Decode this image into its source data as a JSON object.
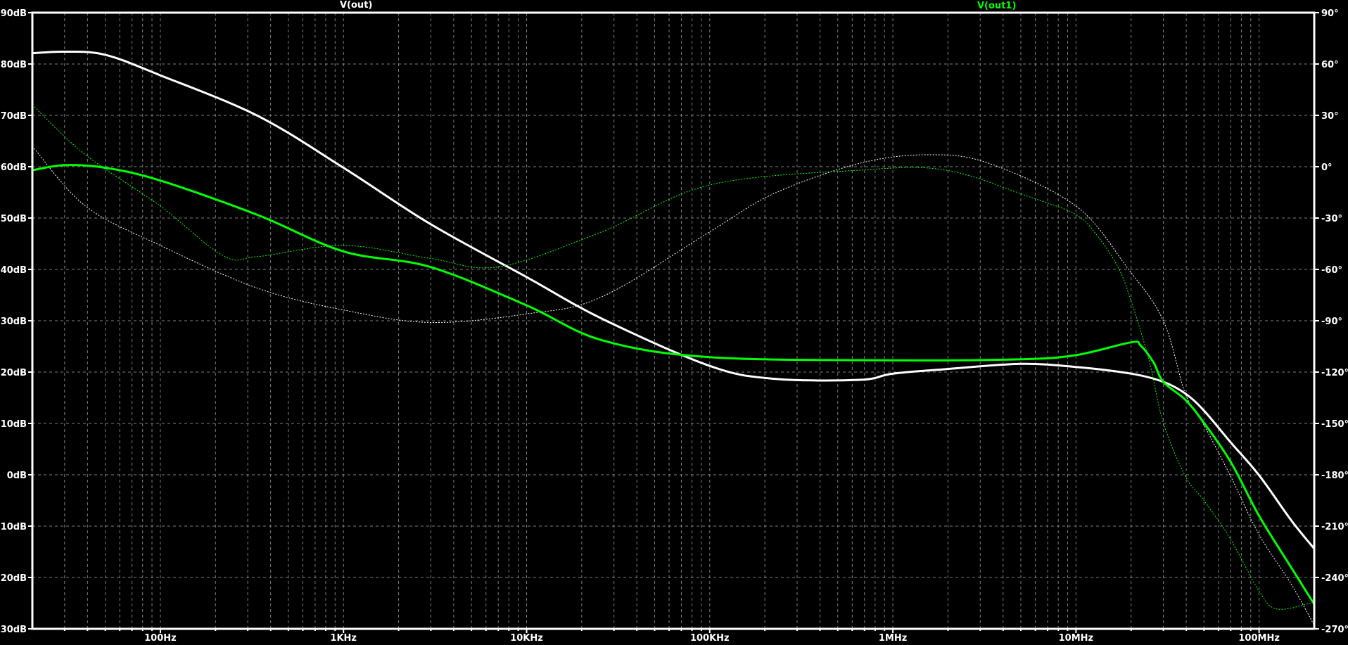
{
  "chart_data": {
    "type": "line",
    "title": "",
    "x_scale": "log",
    "xlim_hz": [
      20,
      200000000
    ],
    "ylim_left_db": [
      -30,
      90
    ],
    "ylim_right_deg": [
      -270,
      90
    ],
    "grid": true,
    "background": "#000000",
    "grid_color": "#808080",
    "x_ticks": [
      {
        "value": 100,
        "label": "100Hz"
      },
      {
        "value": 1000,
        "label": "1KHz"
      },
      {
        "value": 10000,
        "label": "10KHz"
      },
      {
        "value": 100000,
        "label": "100KHz"
      },
      {
        "value": 1000000,
        "label": "1MHz"
      },
      {
        "value": 10000000,
        "label": "10MHz"
      },
      {
        "value": 100000000,
        "label": "100MHz"
      }
    ],
    "y_left_ticks": [
      {
        "value": 90,
        "label": "90dB"
      },
      {
        "value": 80,
        "label": "80dB"
      },
      {
        "value": 70,
        "label": "70dB"
      },
      {
        "value": 60,
        "label": "60dB"
      },
      {
        "value": 50,
        "label": "50dB"
      },
      {
        "value": 40,
        "label": "40dB"
      },
      {
        "value": 30,
        "label": "30dB"
      },
      {
        "value": 20,
        "label": "20dB"
      },
      {
        "value": 10,
        "label": "10dB"
      },
      {
        "value": 0,
        "label": "0dB"
      },
      {
        "value": -10,
        "label": "-10dB"
      },
      {
        "value": -20,
        "label": "-20dB"
      },
      {
        "value": -30,
        "label": "-30dB"
      }
    ],
    "y_right_ticks": [
      {
        "value": 90,
        "label": "90°"
      },
      {
        "value": 60,
        "label": "60°"
      },
      {
        "value": 30,
        "label": "30°"
      },
      {
        "value": 0,
        "label": "0°"
      },
      {
        "value": -30,
        "label": "-30°"
      },
      {
        "value": -60,
        "label": "-60°"
      },
      {
        "value": -90,
        "label": "-90°"
      },
      {
        "value": -120,
        "label": "-120°"
      },
      {
        "value": -150,
        "label": "-150°"
      },
      {
        "value": -180,
        "label": "-180°"
      },
      {
        "value": -210,
        "label": "-210°"
      },
      {
        "value": -240,
        "label": "-240°"
      },
      {
        "value": -270,
        "label": "-270°"
      }
    ],
    "series": [
      {
        "name": "V(out)",
        "color": "#ffffff",
        "magnitude_db": [
          [
            20,
            82.1
          ],
          [
            30,
            82.4
          ],
          [
            50,
            81.8
          ],
          [
            100,
            77.8
          ],
          [
            340,
            69.9
          ],
          [
            1000,
            59.8
          ],
          [
            2960,
            48.9
          ],
          [
            10000,
            38.5
          ],
          [
            25800,
            30.4
          ],
          [
            100000,
            21.2
          ],
          [
            224000,
            18.7
          ],
          [
            662000,
            18.5
          ],
          [
            1000000,
            19.7
          ],
          [
            2000000,
            20.6
          ],
          [
            5000000,
            21.6
          ],
          [
            10000000,
            21.0
          ],
          [
            20000000,
            19.7
          ],
          [
            30000000,
            18.1
          ],
          [
            39600000,
            15.8
          ],
          [
            50000000,
            12.5
          ],
          [
            70000000,
            6.3
          ],
          [
            100000000,
            -0.1
          ],
          [
            150000000,
            -8.9
          ],
          [
            200000000,
            -14.4
          ]
        ],
        "phase_deg": [
          [
            20,
            12
          ],
          [
            39,
            -23
          ],
          [
            100,
            -46
          ],
          [
            340,
            -71
          ],
          [
            1000,
            -83.7
          ],
          [
            2960,
            -91
          ],
          [
            10000,
            -86
          ],
          [
            25800,
            -76
          ],
          [
            100000,
            -38
          ],
          [
            224000,
            -15.7
          ],
          [
            662000,
            2
          ],
          [
            1570000,
            7
          ],
          [
            3340000,
            2
          ],
          [
            10000000,
            -23
          ],
          [
            19000000,
            -58.8
          ],
          [
            30000000,
            -90
          ],
          [
            39600000,
            -132.8
          ],
          [
            50000000,
            -151
          ],
          [
            70000000,
            -181
          ],
          [
            100000000,
            -215
          ],
          [
            150000000,
            -244
          ],
          [
            200000000,
            -268
          ]
        ]
      },
      {
        "name": "V(out1)",
        "color": "#00ff00",
        "magnitude_db": [
          [
            20,
            59.3
          ],
          [
            30,
            60.3
          ],
          [
            50,
            59.8
          ],
          [
            100,
            57.3
          ],
          [
            340,
            50.6
          ],
          [
            1000,
            43.5
          ],
          [
            2960,
            40.5
          ],
          [
            10000,
            33.0
          ],
          [
            25800,
            26.2
          ],
          [
            100000,
            22.9
          ],
          [
            1000000,
            22.3
          ],
          [
            5000000,
            22.5
          ],
          [
            10000000,
            23.3
          ],
          [
            20000000,
            25.8
          ],
          [
            22500000,
            25.2
          ],
          [
            26500000,
            21.9
          ],
          [
            30000000,
            18.1
          ],
          [
            39600000,
            14.6
          ],
          [
            50000000,
            10.1
          ],
          [
            70000000,
            2.5
          ],
          [
            100000000,
            -8.0
          ],
          [
            150000000,
            -18.1
          ],
          [
            200000000,
            -25.2
          ]
        ],
        "phase_deg": [
          [
            20,
            36.1
          ],
          [
            39,
            7
          ],
          [
            100,
            -23
          ],
          [
            220,
            -52
          ],
          [
            340,
            -52.5
          ],
          [
            1000,
            -46
          ],
          [
            2960,
            -53.5
          ],
          [
            7030,
            -58.5
          ],
          [
            25800,
            -38
          ],
          [
            100000,
            -10.7
          ],
          [
            662000,
            -2
          ],
          [
            1950000,
            -2
          ],
          [
            5700000,
            -18
          ],
          [
            10000000,
            -28
          ],
          [
            13000000,
            -40
          ],
          [
            17000000,
            -58.8
          ],
          [
            20000000,
            -78.5
          ],
          [
            25000000,
            -112.6
          ],
          [
            30000000,
            -149.6
          ],
          [
            39600000,
            -181
          ],
          [
            50000000,
            -195
          ],
          [
            70000000,
            -217.8
          ],
          [
            100000000,
            -248
          ],
          [
            126000000,
            -258.5
          ],
          [
            200000000,
            -254.4
          ]
        ]
      }
    ]
  }
}
